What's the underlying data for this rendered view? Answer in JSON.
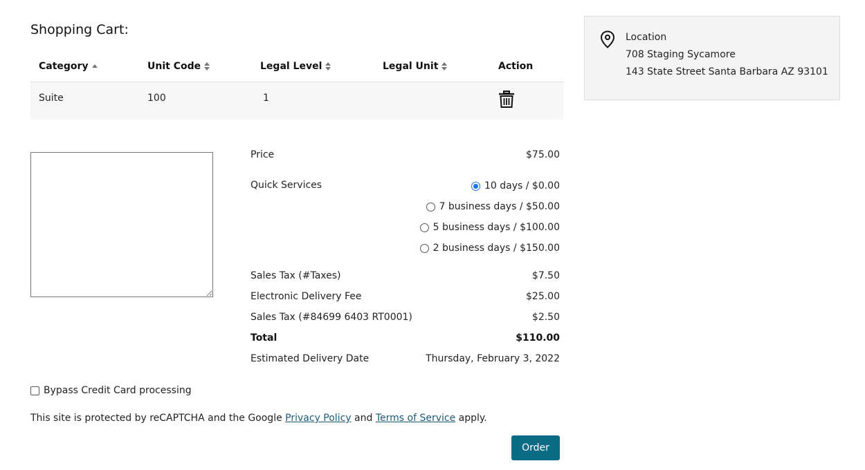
{
  "cart": {
    "title": "Shopping Cart:",
    "columns": [
      "Category",
      "Unit Code",
      "Legal Level",
      "Legal Unit",
      "Action"
    ],
    "rows": [
      {
        "category": "Suite",
        "unit_code": "100",
        "legal_level": "1",
        "legal_unit": ""
      }
    ]
  },
  "summary": {
    "price_label": "Price",
    "price_value": "$75.00",
    "quick_services_label": "Quick Services",
    "quick_options": [
      {
        "label": "10 days / $0.00",
        "checked": true
      },
      {
        "label": "7 business days / $50.00",
        "checked": false
      },
      {
        "label": "5 business days / $100.00",
        "checked": false
      },
      {
        "label": "2 business days / $150.00",
        "checked": false
      }
    ],
    "lines": [
      {
        "label": "Sales Tax (#Taxes)",
        "value": "$7.50"
      },
      {
        "label": "Electronic Delivery Fee",
        "value": "$25.00"
      },
      {
        "label": "Sales Tax (#84699 6403 RT0001)",
        "value": "$2.50"
      }
    ],
    "total_label": "Total",
    "total_value": "$110.00",
    "delivery_label": "Estimated Delivery Date",
    "delivery_value": "Thursday, February 3, 2022"
  },
  "bypass_label": "Bypass Credit Card processing",
  "recaptcha": {
    "prefix": "This site is protected by reCAPTCHA and the Google ",
    "privacy_link": "Privacy Policy",
    "middle": " and ",
    "terms_link": "Terms of Service",
    "suffix": " apply."
  },
  "order_button": "Order",
  "location": {
    "heading": "Location",
    "name": "708 Staging Sycamore",
    "address": "143 State Street Santa Barbara AZ 93101"
  },
  "colors": {
    "accent": "#0b6b84",
    "link": "#1c5a7a",
    "radio_selected": "#1a73e8"
  }
}
